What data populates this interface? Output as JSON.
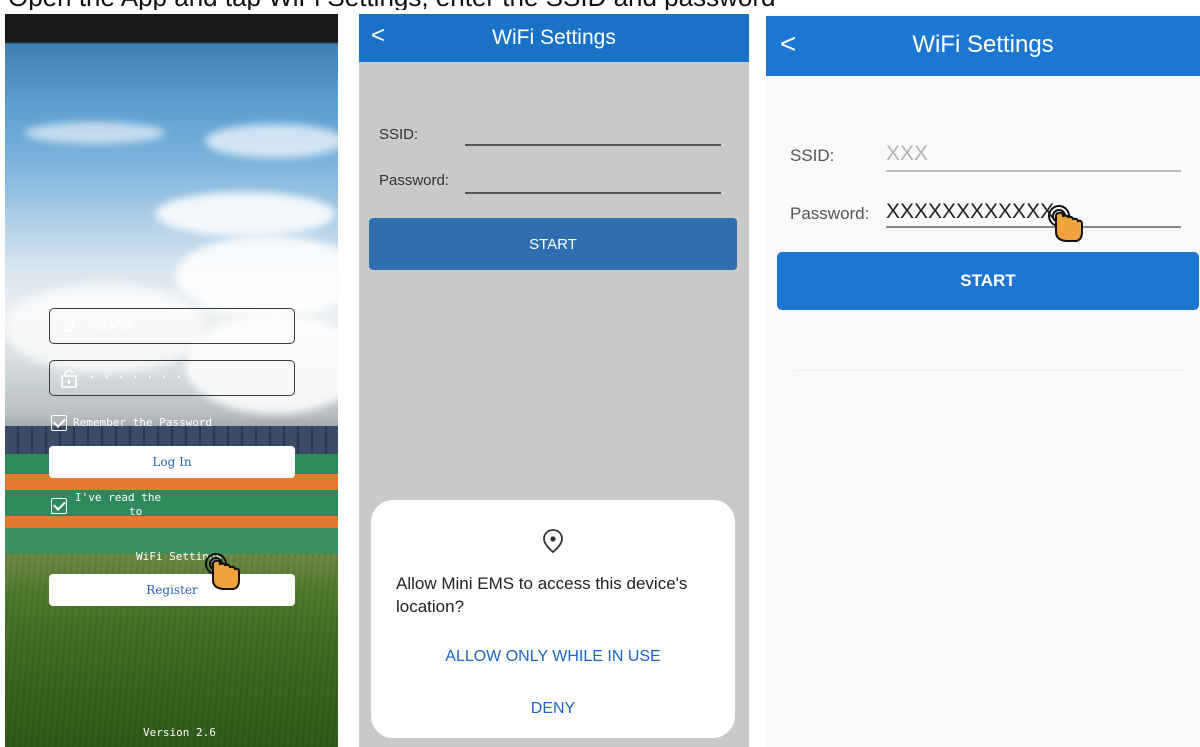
{
  "caption": "Open the App and tap WiFi Settings, enter the SSID and password",
  "login": {
    "username": "Jack55",
    "password_mask": "··········",
    "remember_label": "Remember the Password",
    "login_button": "Log In",
    "agreement_prefix": "I've read the",
    "agreement_to": "to",
    "wifi_settings_link": "WiFi Settings",
    "register_button": "Register",
    "version": "Version 2.6"
  },
  "wifi_dialog_screen": {
    "title": "WiFi Settings",
    "ssid_label": "SSID:",
    "password_label": "Password:",
    "start_button": "START",
    "dialog": {
      "question": "Allow Mini EMS to access this device's location?",
      "allow_option": "ALLOW ONLY WHILE IN USE",
      "deny_option": "DENY"
    }
  },
  "wifi_filled_screen": {
    "title": "WiFi Settings",
    "ssid_label": "SSID:",
    "ssid_value": "XXX",
    "password_label": "Password:",
    "password_value": "XXXXXXXXXXXX",
    "start_button": "START"
  },
  "colors": {
    "header_blue": "#1b77d2",
    "dialog_link_blue": "#1a66c8",
    "hand_orange": "#f0a23c"
  }
}
